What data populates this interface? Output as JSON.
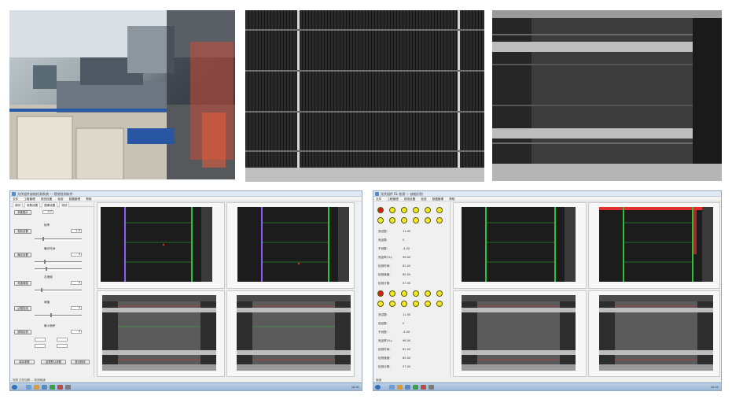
{
  "photos": [
    {
      "name": "equipment photo",
      "icon": "machine-photo"
    },
    {
      "name": "solar cell photo",
      "icon": "solar-cell-photo"
    },
    {
      "name": "el image photo",
      "icon": "el-image-photo"
    }
  ],
  "left_window": {
    "title": "光伏组件缺陷检测系统 — 视觉检测软件",
    "menu": [
      "文件",
      "工程管理",
      "视觉设置",
      "检查",
      "数据管理",
      "帮助"
    ],
    "tabs": [
      "调试",
      "参数设置",
      "图像设置",
      "测试"
    ],
    "controls": [
      {
        "button": "采集图片",
        "value": "0.1"
      },
      {
        "button": "相机设置",
        "label": "帧率",
        "value": "1.0"
      },
      {
        "button": "曝光设置",
        "label": "曝光时间",
        "value": "0"
      },
      {
        "button": "亮度阈值",
        "label": "灰度值",
        "value": "0"
      },
      {
        "button": "边框检测",
        "label": "阈值",
        "value": "0"
      },
      {
        "button": "缺陷检测",
        "label": "最小面积",
        "value": "0"
      }
    ],
    "bottom_buttons": [
      "保存参数",
      "加载默认参数",
      "退出程序"
    ],
    "status": "完成 正在加载 ... 检测就绪",
    "tray_time": "10:31"
  },
  "right_window": {
    "title": "光伏组件 EL 检测 — 缺陷识别",
    "menu": [
      "文件",
      "工程管理",
      "视觉设置",
      "检查",
      "数据管理",
      "帮助"
    ],
    "group1": {
      "dots": [
        "red",
        "yellow",
        "yellow",
        "yellow",
        "yellow",
        "yellow",
        "yellow",
        "yellow",
        "yellow",
        "yellow",
        "yellow",
        "yellow"
      ],
      "rows": [
        {
          "label": "测试数:",
          "value": "11.00"
        },
        {
          "label": "良品数:",
          "value": "0"
        },
        {
          "label": "不良数:",
          "value": "-4.00"
        },
        {
          "label": "良品率(%):",
          "value": "96.00"
        },
        {
          "label": "检测时间:",
          "value": "82.00"
        },
        {
          "label": "检测速度:",
          "value": "85.00"
        },
        {
          "label": "检测计数:",
          "value": "57.00"
        }
      ]
    },
    "group2": {
      "dots": [
        "red",
        "yellow",
        "yellow",
        "yellow",
        "yellow",
        "yellow",
        "yellow",
        "yellow",
        "yellow",
        "yellow",
        "yellow",
        "yellow"
      ],
      "rows": [
        {
          "label": "测试数:",
          "value": "11.00"
        },
        {
          "label": "良品数:",
          "value": "0"
        },
        {
          "label": "不良数:",
          "value": "-4.00"
        },
        {
          "label": "良品率(%):",
          "value": "96.00"
        },
        {
          "label": "检测时间:",
          "value": "82.00"
        },
        {
          "label": "检测速度:",
          "value": "85.00"
        },
        {
          "label": "检测计数:",
          "value": "57.00"
        }
      ]
    },
    "status": "就绪",
    "tray_time": "10:31"
  },
  "colors": {
    "indicator_red": "#d0201e",
    "indicator_yellow": "#f2e82b",
    "cell_grid_green": "#2fbf3a",
    "cell_grid_purple": "#8a5cff",
    "defect_red": "#e03030"
  }
}
